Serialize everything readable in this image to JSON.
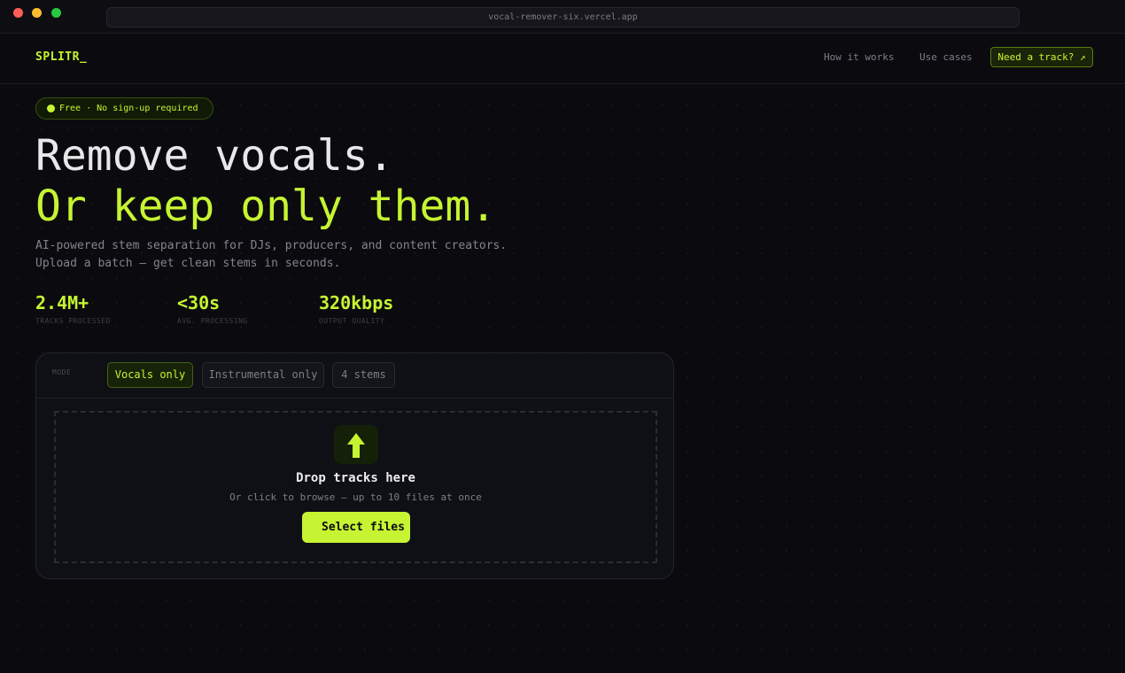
{
  "browser": {
    "url": "vocal-remover-six.vercel.app"
  },
  "nav": {
    "logo": "SPLITR_",
    "links": [
      "How it works",
      "Use cases"
    ],
    "cta": "Need a track? ↗"
  },
  "hero": {
    "badge": "Free · No sign-up required",
    "headline_1": "Remove vocals.",
    "headline_2": "Or keep only them.",
    "sub_1": "AI-powered stem separation for DJs, producers, and content creators.",
    "sub_2": "Upload a batch — get clean stems in seconds."
  },
  "stats": [
    {
      "value": "2.4M+",
      "label": "TRACKS PROCESSED"
    },
    {
      "value": "<30s",
      "label": "AVG. PROCESSING"
    },
    {
      "value": "320kbps",
      "label": "OUTPUT QUALITY"
    }
  ],
  "mode": {
    "label": "MODE",
    "tabs": [
      "Vocals only",
      "Instrumental only",
      "4 stems"
    ],
    "selected": "Vocals only"
  },
  "dropzone": {
    "icon": "upload-arrow-icon",
    "title": "Drop tracks here",
    "subtitle": "Or click to browse — up to 10 files at once",
    "button": "Select files"
  },
  "colors": {
    "accent": "#c6f432",
    "background": "#0b0b0f",
    "card": "#0f1016"
  }
}
